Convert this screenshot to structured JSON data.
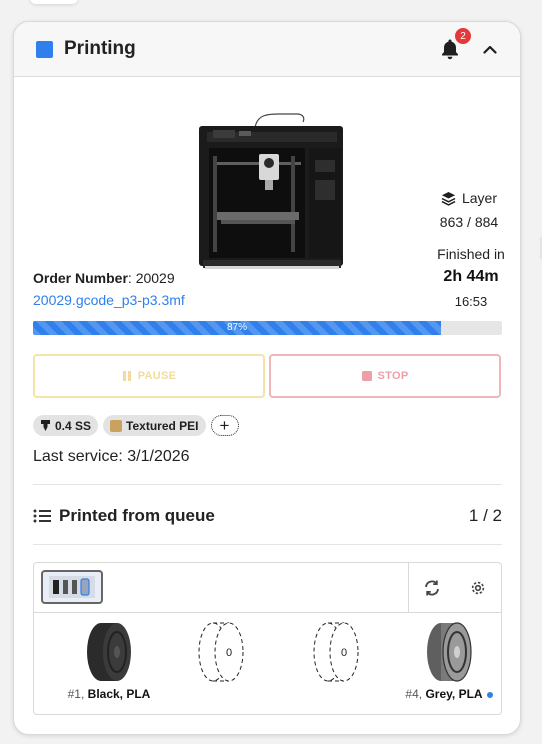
{
  "header": {
    "title": "Printing",
    "status_color": "#2f80ed",
    "notifications_count": "2"
  },
  "job": {
    "order_label": "Order Number",
    "order_number": "20029",
    "file_name": "20029.gcode_p3-p3.3mf",
    "progress_percent": 87,
    "progress_text": "87%"
  },
  "layer": {
    "label": "Layer",
    "value": "863 / 884"
  },
  "finish": {
    "label": "Finished in",
    "remaining": "2h 44m",
    "clock": "16:53"
  },
  "controls": {
    "pause_label": "PAUSE",
    "stop_label": "STOP"
  },
  "chips": {
    "nozzle": "0.4 SS",
    "plate": "Textured PEI",
    "add": "+"
  },
  "service": {
    "text": "Last service: 3/1/2026"
  },
  "queue": {
    "title": "Printed from queue",
    "count": "1 / 2"
  },
  "ams": {
    "slots": [
      {
        "num": "#1,",
        "name": "Black, PLA",
        "color": "#2b2b2b",
        "empty": false,
        "active": false
      },
      {
        "num": "",
        "name": "",
        "empty": true,
        "empty_text": "0"
      },
      {
        "num": "",
        "name": "",
        "empty": true,
        "empty_text": "0"
      },
      {
        "num": "#4,",
        "name": "Grey, PLA",
        "color": "#8d8d8d",
        "empty": false,
        "active": true
      }
    ]
  }
}
